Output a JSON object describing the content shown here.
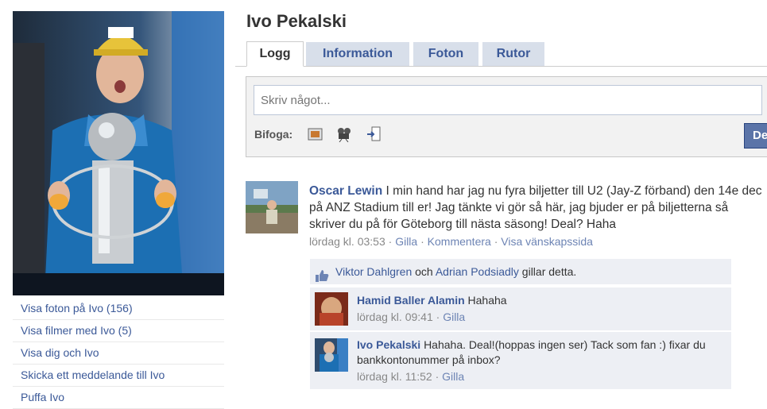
{
  "profile": {
    "name": "Ivo Pekalski",
    "links": [
      "Visa foton på Ivo (156)",
      "Visa filmer med Ivo (5)",
      "Visa dig och Ivo",
      "Skicka ett meddelande till Ivo",
      "Puffa Ivo"
    ]
  },
  "tabs": [
    "Logg",
    "Information",
    "Foton",
    "Rutor"
  ],
  "composer": {
    "placeholder": "Skriv något...",
    "attach_label": "Bifoga:",
    "share_label": "De"
  },
  "post": {
    "author": "Oscar Lewin",
    "text": "I min hand har jag nu fyra biljetter till U2 (Jay-Z förband) den 14e dec på ANZ Stadium till er! Jag tänkte vi gör så här, jag bjuder er på biljetterna så skriver du på för Göteborg till nästa säsong! Deal? Haha",
    "time": "lördag kl. 03:53",
    "sep": "·",
    "like": "Gilla",
    "comment": "Kommentera",
    "friendship": "Visa vänskapssida"
  },
  "likes": {
    "user1": "Viktor Dahlgren",
    "and": "och",
    "user2": "Adrian Podsiadly",
    "suffix": "gillar detta."
  },
  "comments": [
    {
      "author": "Hamid Baller Alamin",
      "text": "Hahaha",
      "time": "lördag kl. 09:41",
      "like": "Gilla"
    },
    {
      "author": "Ivo Pekalski",
      "text": "Hahaha. Deal!(hoppas ingen ser) Tack som fan :) fixar du bankkontonummer på inbox?",
      "time": "lördag kl. 11:52",
      "like": "Gilla"
    }
  ]
}
